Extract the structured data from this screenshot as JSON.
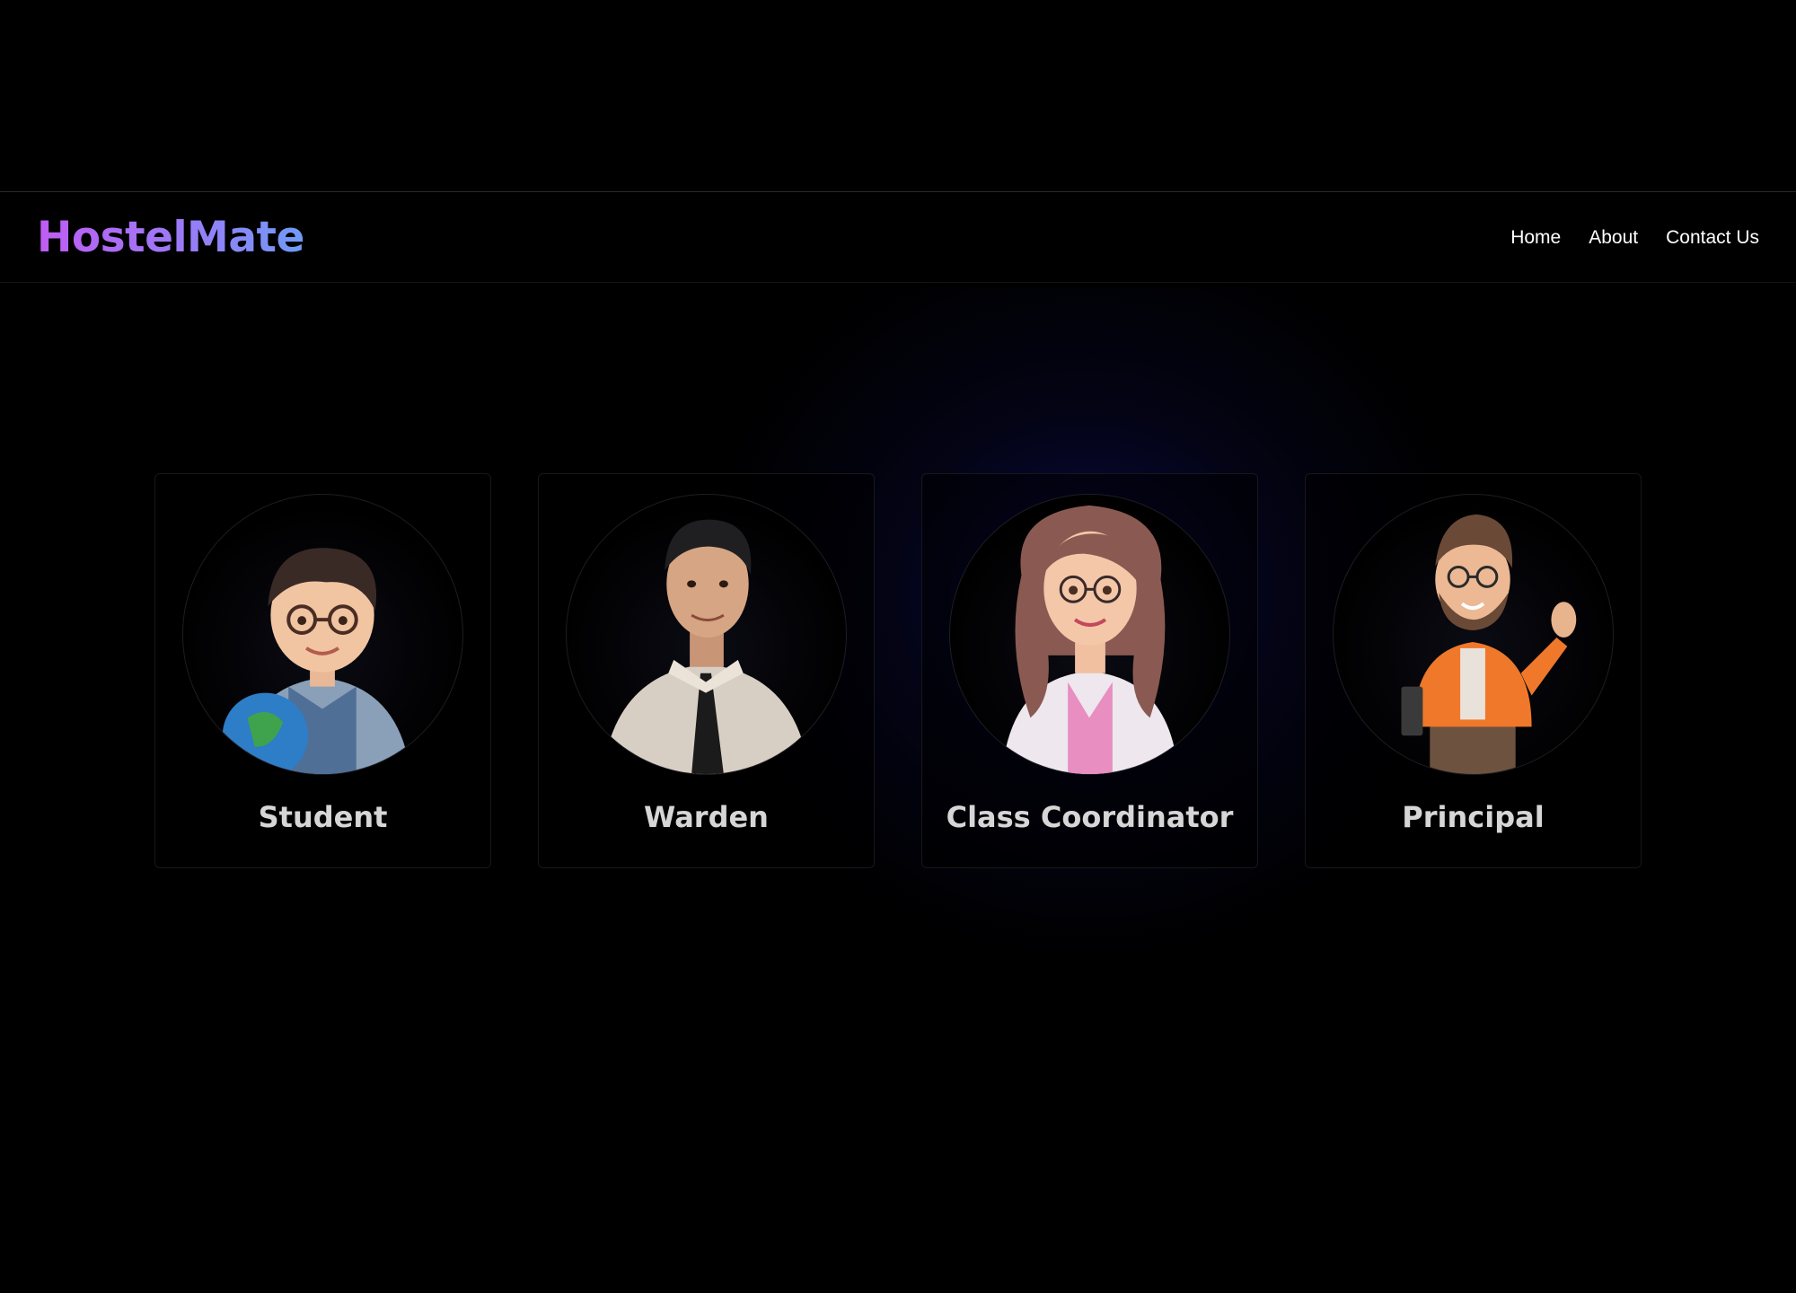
{
  "brand": {
    "name": "HostelMate"
  },
  "nav": {
    "items": [
      "Home",
      "About",
      "Contact Us"
    ]
  },
  "roles": [
    {
      "label": "Student",
      "icon": "student-avatar-icon"
    },
    {
      "label": "Warden",
      "icon": "warden-avatar-icon"
    },
    {
      "label": "Class Coordinator",
      "icon": "coordinator-avatar-icon"
    },
    {
      "label": "Principal",
      "icon": "principal-avatar-icon"
    }
  ],
  "colors": {
    "brand_gradient_start": "#c05cf2",
    "brand_gradient_end": "#6f9bf7",
    "background": "#000000",
    "glow": "#0e0e5c"
  }
}
